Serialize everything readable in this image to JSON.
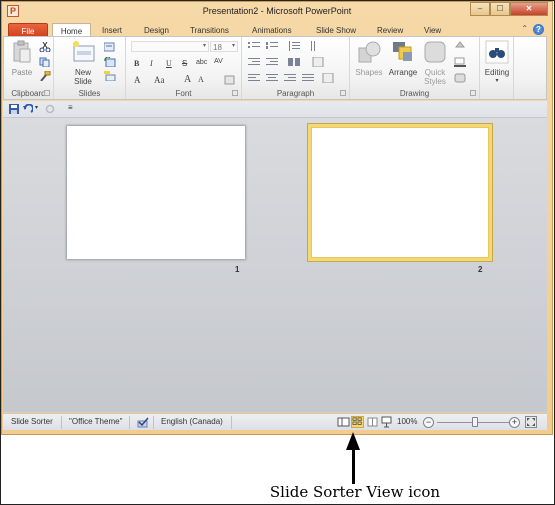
{
  "window": {
    "title": "Presentation2  -  Microsoft PowerPoint",
    "app_icon_glyph": "P",
    "controls": {
      "minimize": "–",
      "maximize": "☐",
      "close": "✕"
    }
  },
  "tabs": [
    "File",
    "Home",
    "Insert",
    "Design",
    "Transitions",
    "Animations",
    "Slide Show",
    "Review",
    "View"
  ],
  "active_tab": "Home",
  "ribbon": {
    "clipboard": {
      "label": "Clipboard",
      "paste": "Paste"
    },
    "slides": {
      "label": "Slides",
      "new_slide_line1": "New",
      "new_slide_line2": "Slide"
    },
    "font": {
      "label": "Font",
      "font_size": "18",
      "bold": "B",
      "italic": "I",
      "underline": "U",
      "strike": "S",
      "shadow": "abc",
      "spacing": "AV",
      "color": "A",
      "case": "Aa",
      "grow": "A",
      "shrink": "A"
    },
    "paragraph": {
      "label": "Paragraph"
    },
    "drawing": {
      "label": "Drawing",
      "shapes": "Shapes",
      "arrange": "Arrange",
      "quick_line1": "Quick",
      "quick_line2": "Styles"
    },
    "editing": {
      "label": "Editing"
    }
  },
  "slides": [
    {
      "number": "1",
      "selected": false
    },
    {
      "number": "2",
      "selected": true
    }
  ],
  "status_bar": {
    "view_name": "Slide Sorter",
    "theme": "\"Office Theme\"",
    "language": "English (Canada)",
    "zoom": "100%",
    "zoom_fraction": 0.5,
    "active_view": "slide-sorter"
  },
  "annotation": {
    "caption": "Slide Sorter View icon"
  },
  "colors": {
    "file_tab": "#d2401d",
    "selection": "#f3d878",
    "window_frame": "#f2cc8e"
  }
}
